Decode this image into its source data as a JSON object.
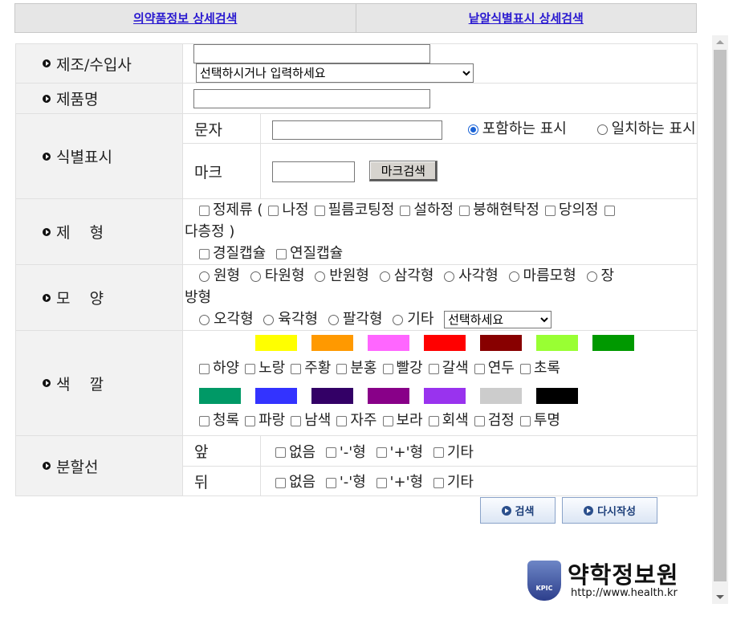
{
  "tabs": {
    "detail": "의약품정보 상세검색",
    "pill": "낱알식별표시 상세검색"
  },
  "maker": {
    "label": "제조/수입사",
    "select_value": "선택하시거나 입력하세요"
  },
  "product": {
    "label": "제품명"
  },
  "marking": {
    "label": "식별표시",
    "text_label": "문자",
    "contains": "포함하는 표시",
    "exact": "일치하는 표시",
    "mark_label": "마크",
    "mark_button": "마크검색"
  },
  "form": {
    "label": "제    형",
    "tablet": "정제류",
    "paren_open": "(",
    "plain": "나정",
    "film": "필름코팅정",
    "sublingual": "설하정",
    "effervescent": "붕해현탁정",
    "sugar": "당의정",
    "multilayer": "다층정",
    "paren_close": ")",
    "hard": "경질캡슐",
    "soft": "연질캡슐"
  },
  "shape": {
    "label": "모    양",
    "opts": [
      "원형",
      "타원형",
      "반원형",
      "삼각형",
      "사각형",
      "마름모형"
    ],
    "wrap_a": "장",
    "wrap_b": "방형",
    "opts2": [
      "오각형",
      "육각형",
      "팔각형",
      "기타"
    ],
    "select_value": "선택하세요"
  },
  "color": {
    "label": "색    깔",
    "row1": [
      "하양",
      "노랑",
      "주황",
      "분홍",
      "빨강",
      "갈색",
      "연두",
      "초록"
    ],
    "swatches1": [
      "#ffff00",
      "#ff9900",
      "#ff66ff",
      "#ff0000",
      "#880000",
      "#99ff33",
      "#009900"
    ],
    "row2": [
      "청록",
      "파랑",
      "남색",
      "자주",
      "보라",
      "회색",
      "검정",
      "투명"
    ],
    "swatches2": [
      "#009966",
      "#3333ff",
      "#330066",
      "#880088",
      "#9933ee",
      "#cccccc",
      "#000000"
    ]
  },
  "score": {
    "label": "분할선",
    "front": "앞",
    "back": "뒤",
    "opts": [
      "없음",
      "'-'형",
      "'+'형",
      "기타"
    ]
  },
  "actions": {
    "search": "검색",
    "reset": "다시작성"
  },
  "logo": {
    "name": "약학정보원",
    "url": "http://www.health.kr",
    "badge": "KPIC"
  }
}
